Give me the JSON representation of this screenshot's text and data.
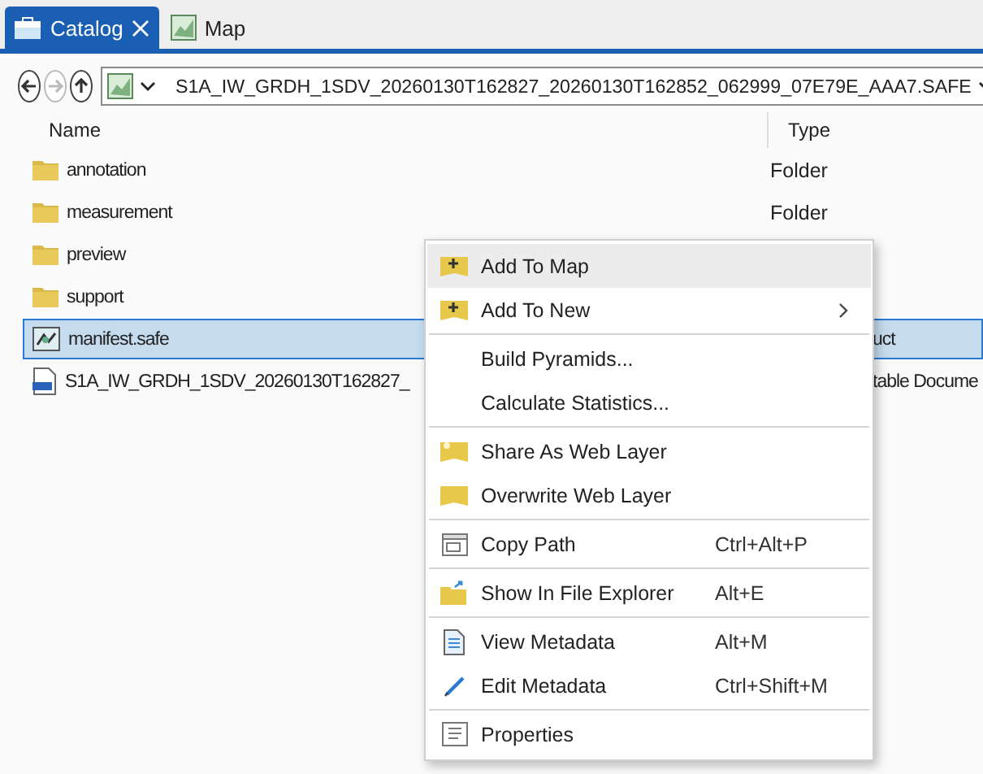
{
  "tabs": [
    {
      "label": "Catalog",
      "selected": true,
      "closable": true
    },
    {
      "label": "Map",
      "selected": false,
      "closable": false
    }
  ],
  "navigation": {
    "back_disabled": false,
    "forward_disabled": true,
    "up_disabled": false
  },
  "address": {
    "path": "S1A_IW_GRDH_1SDV_20260130T162827_20260130T162852_062999_07E79E_AAA7.SAFE"
  },
  "table": {
    "columns": [
      "Name",
      "Type"
    ],
    "rows": [
      {
        "kind": "folder",
        "name": "annotation",
        "type": "Folder",
        "selected": false
      },
      {
        "kind": "folder",
        "name": "measurement",
        "type": "Folder",
        "selected": false
      },
      {
        "kind": "folder",
        "name": "preview",
        "selected": false
      },
      {
        "kind": "folder",
        "name": "support",
        "selected": false
      },
      {
        "kind": "product",
        "name": "manifest.safe",
        "type": "uct",
        "selected": true
      },
      {
        "kind": "pdf",
        "name": "S1A_IW_GRDH_1SDV_20260130T162827_",
        "type": "table Docume",
        "selected": false
      }
    ]
  },
  "context_menu": {
    "groups": [
      [
        {
          "kind": "add",
          "label": "Add To Map",
          "highlighted": true,
          "submenu": false
        },
        {
          "kind": "add",
          "label": "Add To New",
          "highlighted": false,
          "submenu": true
        }
      ],
      [
        {
          "kind": "plain",
          "label": "Build Pyramids...",
          "highlighted": false,
          "submenu": false
        },
        {
          "kind": "plain",
          "label": "Calculate Statistics...",
          "highlighted": false,
          "submenu": false
        }
      ],
      [
        {
          "kind": "share",
          "label": "Share As Web Layer",
          "highlighted": false,
          "submenu": false
        },
        {
          "kind": "overwrite",
          "label": "Overwrite Web Layer",
          "highlighted": false,
          "submenu": false
        }
      ],
      [
        {
          "kind": "copy",
          "label": "Copy Path",
          "shortcut": "Ctrl+Alt+P",
          "highlighted": false,
          "submenu": false
        }
      ],
      [
        {
          "kind": "explore",
          "label": "Show In File Explorer",
          "shortcut": "Alt+E",
          "highlighted": false,
          "submenu": false
        }
      ],
      [
        {
          "kind": "view",
          "label": "View Metadata",
          "shortcut": "Alt+M",
          "highlighted": false,
          "submenu": false
        },
        {
          "kind": "edit",
          "label": "Edit Metadata",
          "shortcut": "Ctrl+Shift+M",
          "highlighted": false,
          "submenu": false
        }
      ],
      [
        {
          "kind": "properties",
          "label": "Properties",
          "highlighted": false,
          "submenu": false
        }
      ]
    ]
  }
}
